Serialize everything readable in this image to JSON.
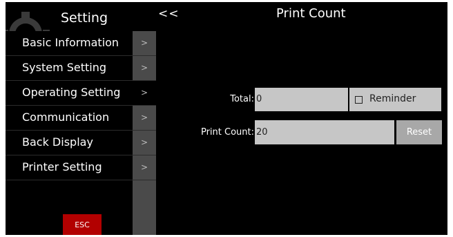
{
  "sidebar": {
    "title": "Setting",
    "items": [
      {
        "label": "Basic Information",
        "chevron": ">"
      },
      {
        "label": "System Setting",
        "chevron": ">"
      },
      {
        "label": "Operating Setting",
        "chevron": ">"
      },
      {
        "label": "Communication",
        "chevron": ">"
      },
      {
        "label": "Back Display",
        "chevron": ">"
      },
      {
        "label": "Printer Setting",
        "chevron": ">"
      }
    ],
    "esc_label": "ESC"
  },
  "header": {
    "back_label": "<<",
    "title": "Print Count"
  },
  "form": {
    "total_label": "Total:",
    "total_value": "0",
    "reminder_label": "Reminder",
    "print_count_label": "Print Count:",
    "print_count_value": "20",
    "reset_label": "Reset"
  },
  "colors": {
    "background": "#000000",
    "esc_button": "#b20000",
    "field": "#c6c6c6",
    "reset_button": "#a8a8a8"
  }
}
